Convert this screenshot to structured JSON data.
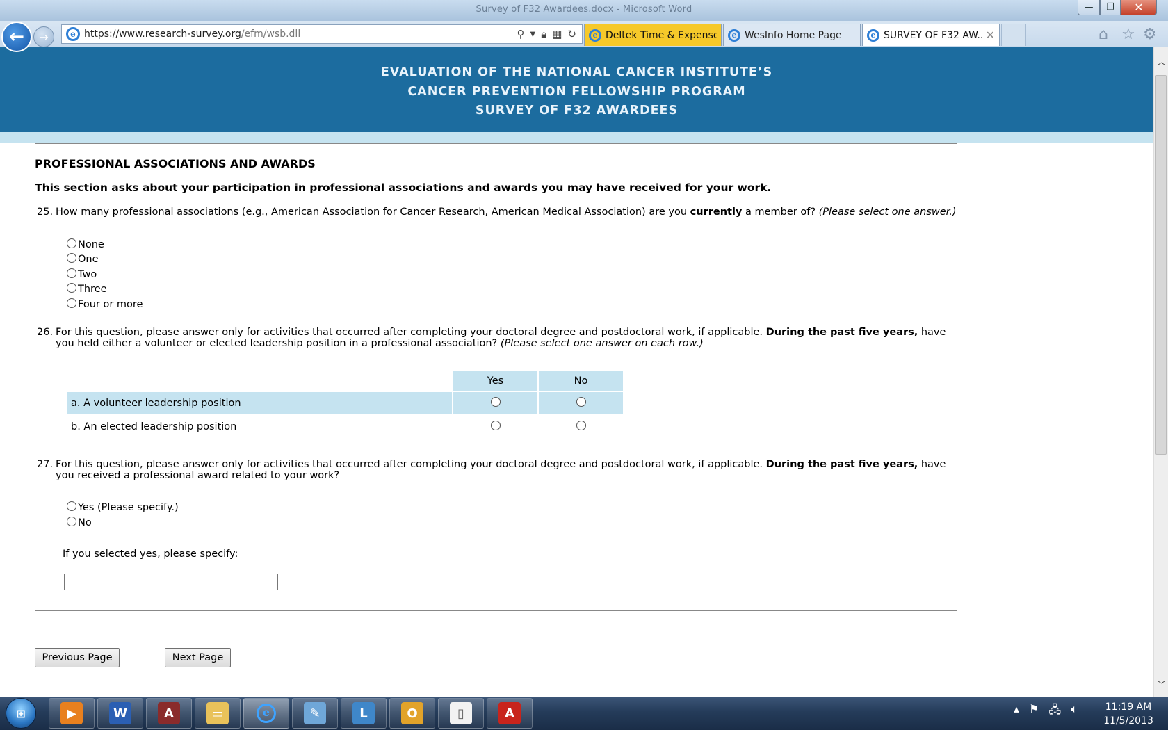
{
  "window": {
    "title": "Survey of F32 Awardees.docx - Microsoft Word",
    "min_glyph": "—",
    "max_glyph": "❐",
    "close_glyph": "✕"
  },
  "browser": {
    "url_host": "https://www.research-survey.org",
    "url_path": "/efm/wsb.dll",
    "tabs": [
      {
        "label": "Deltek Time & Expense..."
      },
      {
        "label": "WesInfo Home Page"
      },
      {
        "label": "SURVEY OF F32 AW..."
      }
    ]
  },
  "banner": {
    "line1": "EVALUATION OF THE NATIONAL CANCER INSTITUTE’S",
    "line2": "CANCER PREVENTION FELLOWSHIP PROGRAM",
    "line3": "SURVEY OF F32 AWARDEES"
  },
  "section": {
    "title": "PROFESSIONAL ASSOCIATIONS AND AWARDS",
    "intro": "This section asks about your participation in professional associations and awards you may have received for your work."
  },
  "q25": {
    "num": "25.",
    "text_a": "How many professional associations (e.g., American Association for Cancer Research, American Medical Association) are you ",
    "text_bold": "currently",
    "text_b": " a member of? ",
    "text_italic": "(Please select one answer.)",
    "options": [
      "None",
      "One",
      "Two",
      "Three",
      "Four or more"
    ]
  },
  "q26": {
    "num": "26.",
    "text_a": "For this question, please answer only for activities that occurred after completing your doctoral degree and postdoctoral work, if applicable. ",
    "text_bold": "During the past five years,",
    "text_b": " have you held either a volunteer or elected leadership position in a professional association? ",
    "text_italic": "(Please select one answer on each row.)",
    "col_yes": "Yes",
    "col_no": "No",
    "rows": [
      "a. A volunteer leadership position",
      "b. An elected leadership position"
    ]
  },
  "q27": {
    "num": "27.",
    "text_a": "For this question, please answer only for activities that occurred after completing your doctoral degree and postdoctoral work, if applicable. ",
    "text_bold": "During the past five years,",
    "text_b": " have you received a professional award related to your work?",
    "options": [
      "Yes (Please specify.)",
      "No"
    ],
    "specify_label": "If you selected yes, please specify:",
    "specify_value": ""
  },
  "nav": {
    "prev": "Previous Page",
    "next": "Next Page"
  },
  "taskbar": {
    "time": "11:19 AM",
    "date": "11/5/2013"
  },
  "colors": {
    "banner": "#1c6c9f",
    "light_blue": "#c5e3f0",
    "active_tab": "#f6c92a"
  }
}
